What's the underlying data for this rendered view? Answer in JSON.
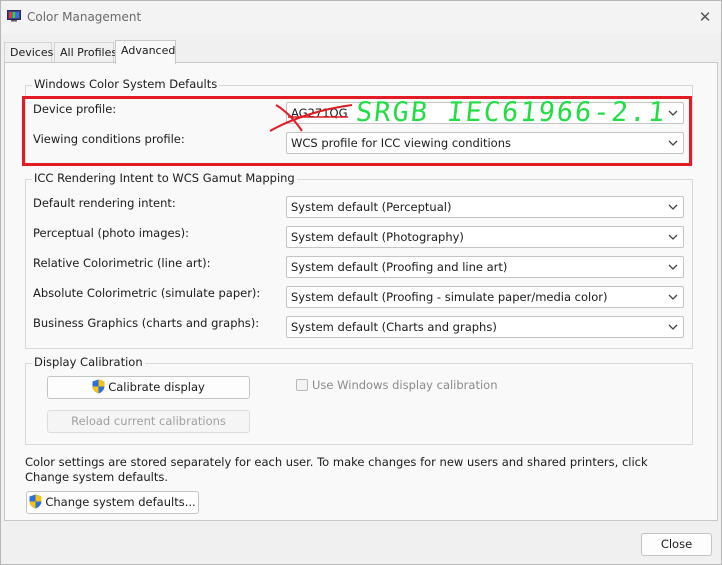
{
  "window": {
    "title": "Color Management",
    "close_glyph": "✕"
  },
  "tabs": [
    {
      "label": "Devices",
      "active": false
    },
    {
      "label": "All Profiles",
      "active": false
    },
    {
      "label": "Advanced",
      "active": true
    }
  ],
  "wcs_defaults": {
    "title": "Windows Color System Defaults",
    "device_profile_label": "Device profile:",
    "device_profile_value": "AG271QG",
    "viewing_conditions_label": "Viewing conditions profile:",
    "viewing_conditions_value": "WCS profile for ICC viewing conditions"
  },
  "annotation": {
    "handwritten_text": "SRGB IEC61966-2.1",
    "color": "#22dd44",
    "box_color": "#e21b24"
  },
  "icc_mapping": {
    "title": "ICC Rendering Intent to WCS Gamut Mapping",
    "rows": [
      {
        "label": "Default rendering intent:",
        "value": "System default (Perceptual)"
      },
      {
        "label": "Perceptual (photo images):",
        "value": "System default (Photography)"
      },
      {
        "label": "Relative Colorimetric (line art):",
        "value": "System default (Proofing and line art)"
      },
      {
        "label": "Absolute Colorimetric (simulate paper):",
        "value": "System default (Proofing - simulate paper/media color)"
      },
      {
        "label": "Business Graphics (charts and graphs):",
        "value": "System default (Charts and graphs)"
      }
    ]
  },
  "calibration": {
    "title": "Display Calibration",
    "calibrate_label": "Calibrate display",
    "reload_label": "Reload current calibrations",
    "use_windows_label": "Use Windows display calibration",
    "use_windows_checked": false
  },
  "footer": {
    "note": "Color settings are stored separately for each user. To make changes for new users and shared printers, click Change system defaults.",
    "change_defaults_label": "Change system defaults...",
    "close_label": "Close"
  },
  "icons": {
    "app": "color-management-icon",
    "shield": "uac-shield-icon",
    "chevron": "chevron-down-icon"
  }
}
